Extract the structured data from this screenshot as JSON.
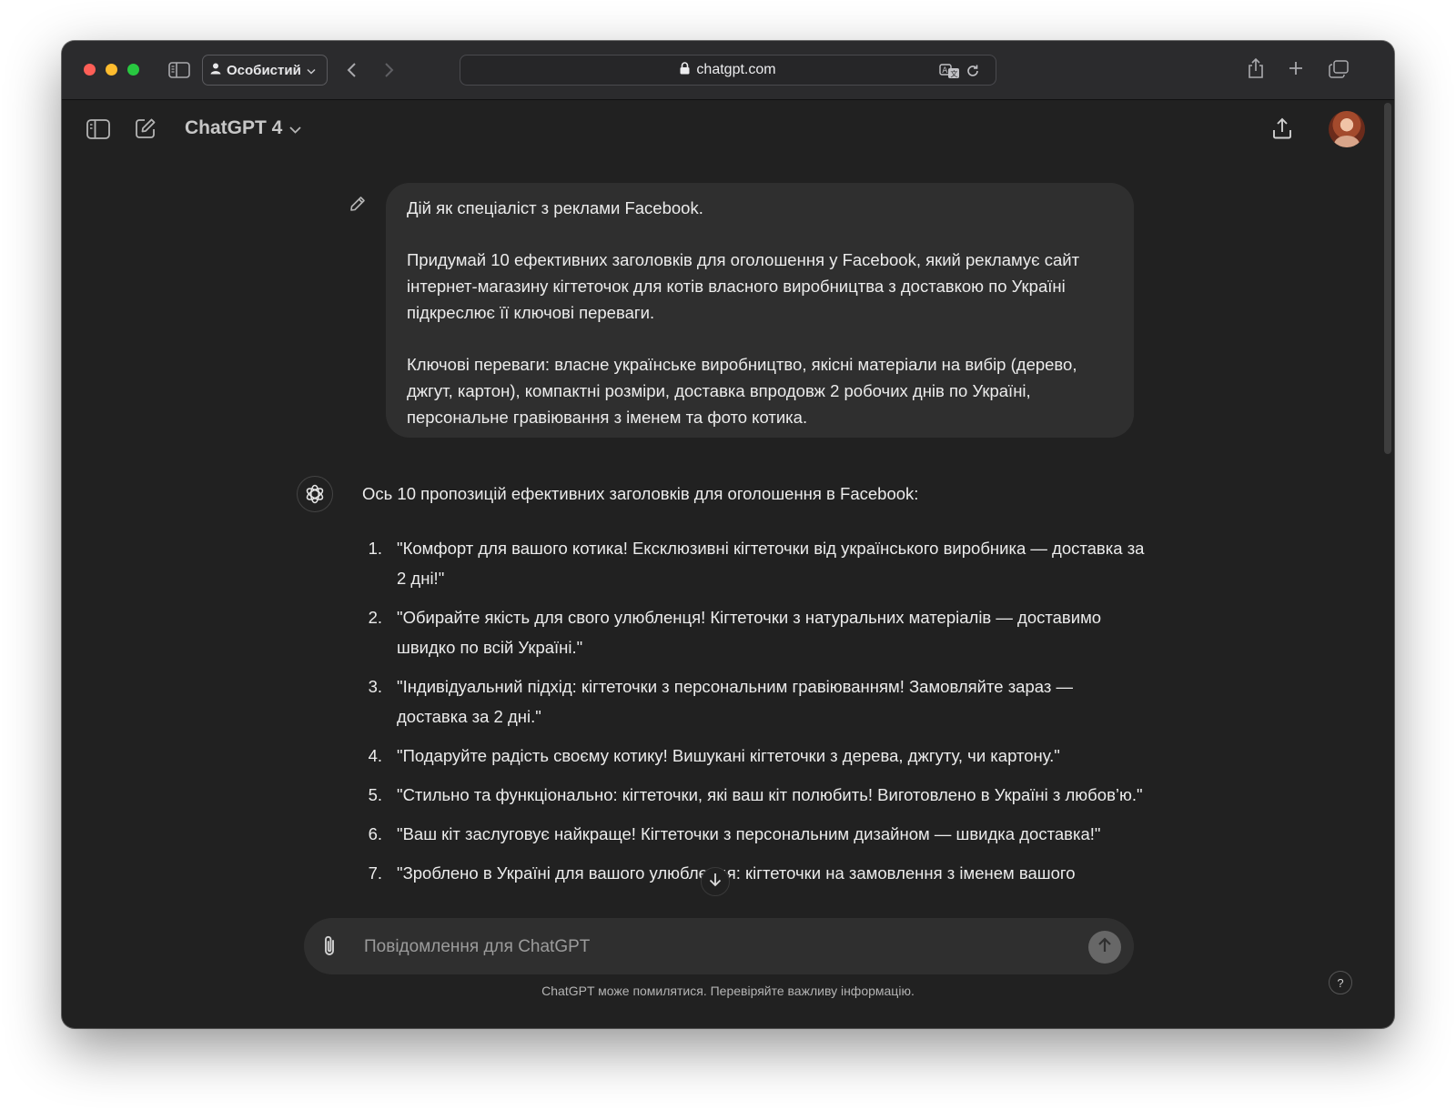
{
  "browser": {
    "profile_label": "Особистий",
    "url": "chatgpt.com"
  },
  "app": {
    "model_name": "ChatGPT 4"
  },
  "conversation": {
    "user_message": [
      "Дій як спеціаліст з реклами Facebook.",
      "Придумай 10 ефективних заголовків для оголошення у Facebook, який рекламує сайт інтернет-магазину кігтеточок для котів власного виробництва з доставкою по Україні підкреслює її ключові переваги.",
      "Ключові переваги: власне українське виробництво, якісні матеріали на вибір (дерево, джгут, картон), компактні розміри, доставка впродовж 2 робочих днів по Україні, персональне гравіювання з іменем та фото котика."
    ],
    "assistant_intro": "Ось 10 пропозицій ефективних заголовків для оголошення в Facebook:",
    "assistant_items": [
      {
        "num": "1.",
        "text": "\"Комфорт для вашого котика! Ексклюзивні кігтеточки від українського виробника — доставка за 2 дні!\""
      },
      {
        "num": "2.",
        "text": "\"Обирайте якість для свого улюбленця! Кігтеточки з натуральних матеріалів — доставимо швидко по всій Україні.\""
      },
      {
        "num": "3.",
        "text": "\"Індивідуальний підхід: кігтеточки з персональним гравіюванням! Замовляйте зараз — доставка за 2 дні.\""
      },
      {
        "num": "4.",
        "text": "\"Подаруйте радість своєму котику! Вишукані кігтеточки з дерева, джгуту, чи картону.\""
      },
      {
        "num": "5.",
        "text": "\"Стильно та функціонально: кігтеточки, які ваш кіт полюбить! Виготовлено в Україні з любов’ю.\""
      },
      {
        "num": "6.",
        "text": "\"Ваш кіт заслуговує найкраще! Кігтеточки з персональним дизайном — швидка доставка!\""
      },
      {
        "num": "7.",
        "text": "\"Зроблено в Україні для вашого улюбленця: кігтеточки на замовлення з іменем вашого"
      }
    ]
  },
  "composer": {
    "placeholder": "Повідомлення для ChatGPT"
  },
  "footer": {
    "disclaimer": "ChatGPT може помилятися. Перевіряйте важливу інформацію.",
    "help_label": "?"
  },
  "colors": {
    "background": "#212121",
    "bubble": "#2f2f2f",
    "text": "#ececec"
  }
}
